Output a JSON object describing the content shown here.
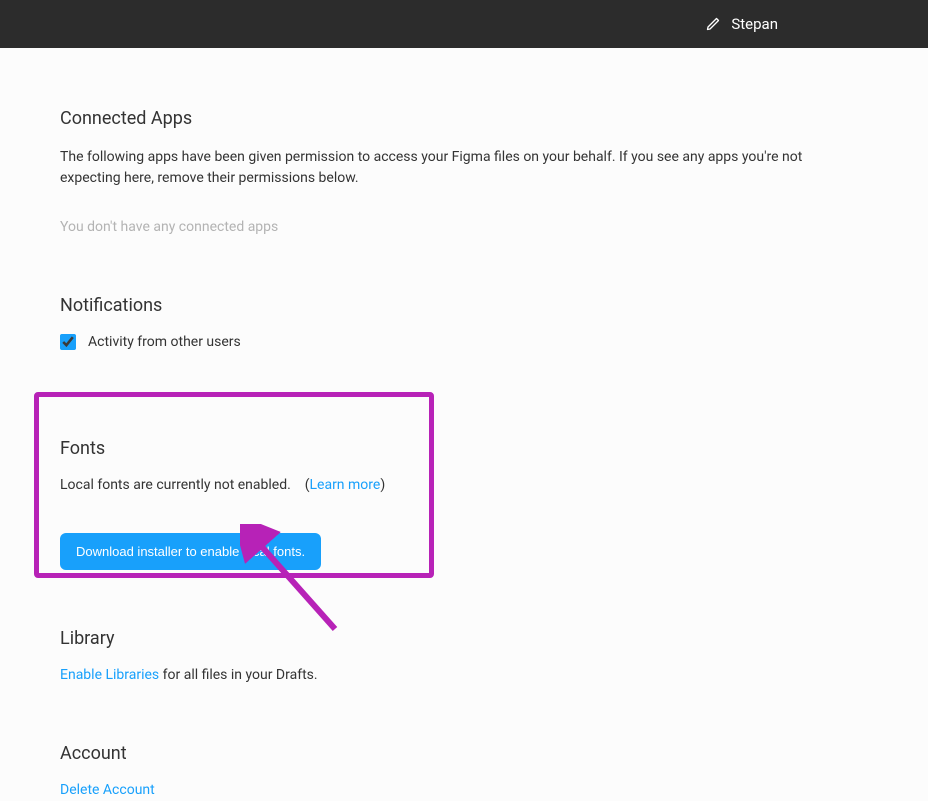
{
  "header": {
    "username": "Stepan"
  },
  "connectedApps": {
    "title": "Connected Apps",
    "description": "The following apps have been given permission to access your Figma files on your behalf. If you see any apps you're not expecting here, remove their permissions below.",
    "empty": "You don't have any connected apps"
  },
  "notifications": {
    "title": "Notifications",
    "activityLabel": "Activity from other users",
    "activityChecked": true
  },
  "fonts": {
    "title": "Fonts",
    "status": "Local fonts are currently not enabled.",
    "learnMore": "Learn more",
    "downloadLabel": "Download installer to enable local fonts."
  },
  "library": {
    "title": "Library",
    "linkText": "Enable Libraries",
    "tailText": " for all files in your Drafts."
  },
  "account": {
    "title": "Account",
    "deleteLink": "Delete Account"
  }
}
